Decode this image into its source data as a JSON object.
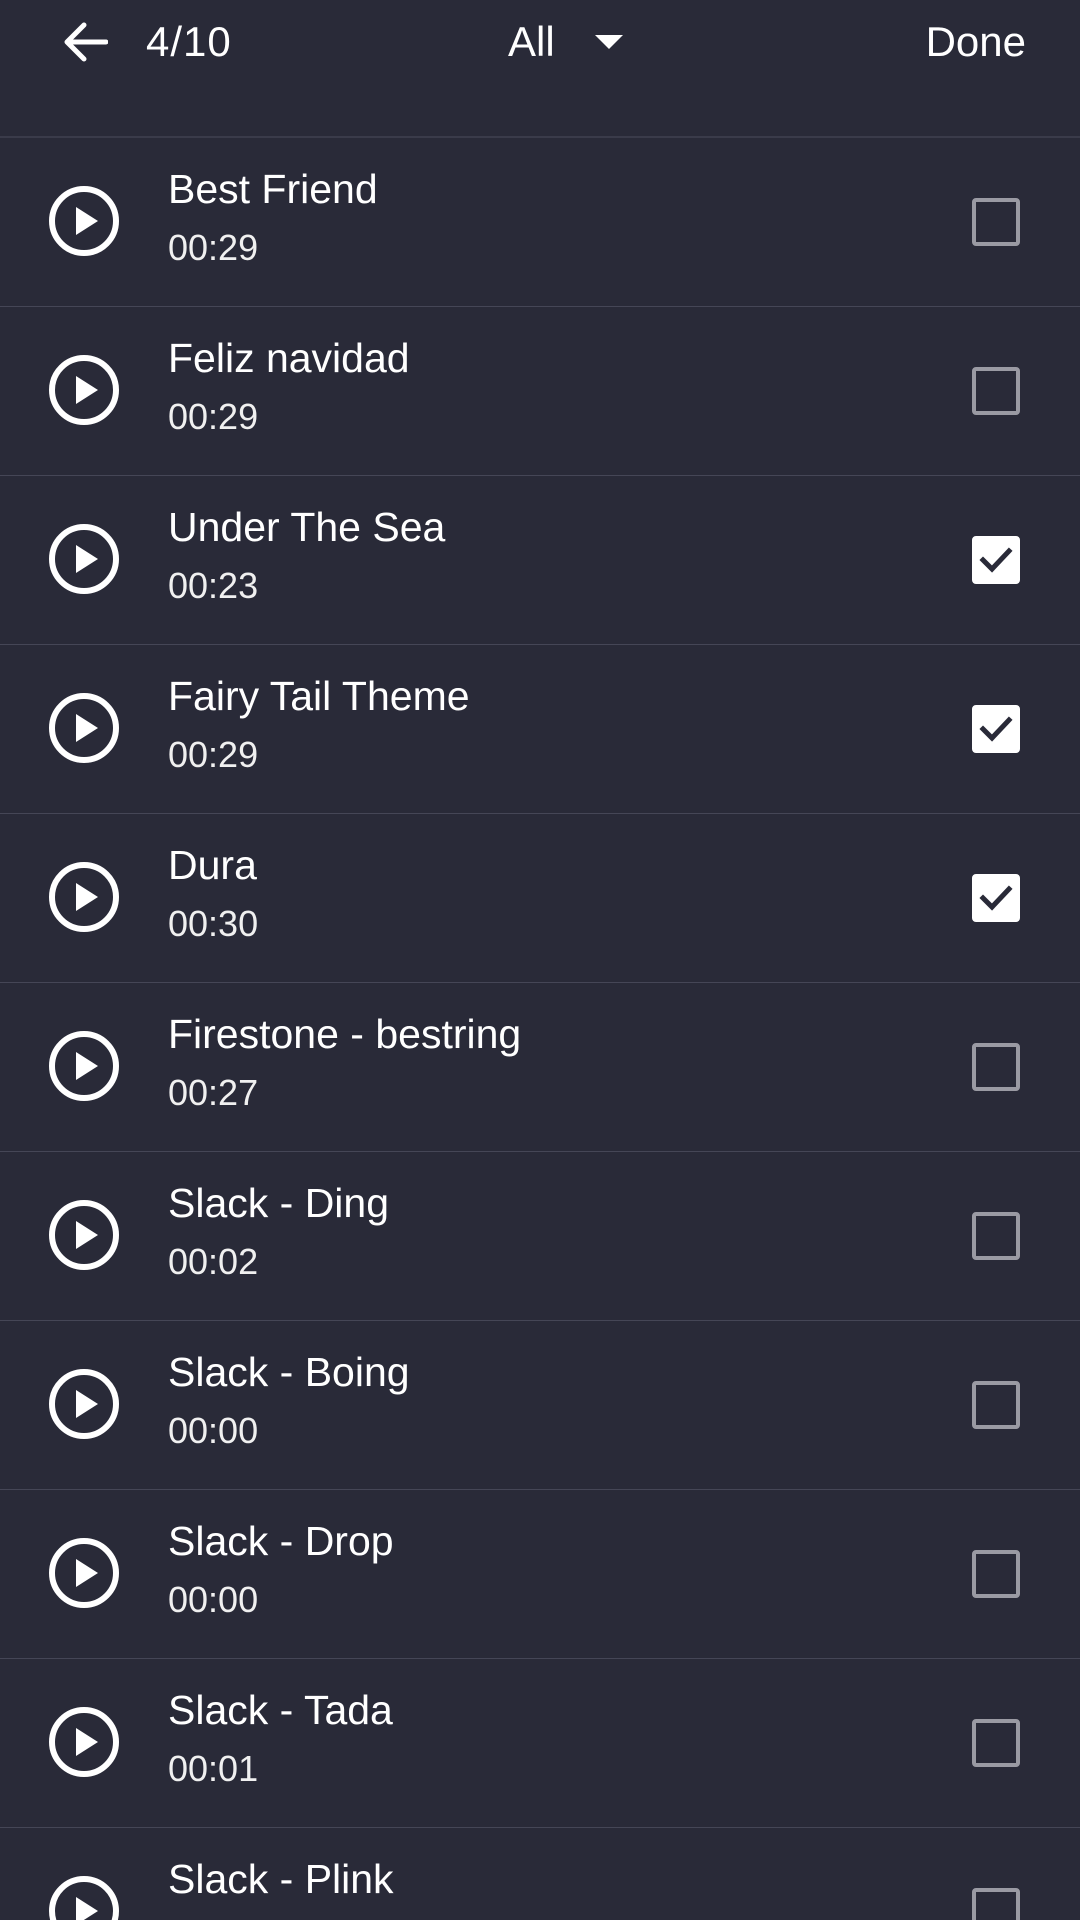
{
  "toolbar": {
    "counter": "4/10",
    "filter_label": "All",
    "done_label": "Done"
  },
  "songs": [
    {
      "title": "Best Friend",
      "duration": "00:29",
      "checked": false
    },
    {
      "title": "Feliz navidad",
      "duration": "00:29",
      "checked": false
    },
    {
      "title": "Under The Sea",
      "duration": "00:23",
      "checked": true
    },
    {
      "title": "Fairy Tail Theme",
      "duration": "00:29",
      "checked": true
    },
    {
      "title": "Dura",
      "duration": "00:30",
      "checked": true
    },
    {
      "title": "Firestone - bestring",
      "duration": "00:27",
      "checked": false
    },
    {
      "title": "Slack - Ding",
      "duration": "00:02",
      "checked": false
    },
    {
      "title": "Slack - Boing",
      "duration": "00:00",
      "checked": false
    },
    {
      "title": "Slack - Drop",
      "duration": "00:00",
      "checked": false
    },
    {
      "title": "Slack - Tada",
      "duration": "00:01",
      "checked": false
    },
    {
      "title": "Slack - Plink",
      "duration": "",
      "checked": false
    }
  ],
  "colors": {
    "background": "#292a38",
    "divider": "#454656",
    "checkbox_unchecked": "#9a9aa3",
    "checkbox_checked": "#ffffff",
    "checkmark": "#292a38"
  },
  "icons": {
    "back": "arrow-left-icon",
    "filter_caret": "caret-down-icon",
    "play": "play-circle-icon",
    "check": "checkmark-icon"
  }
}
